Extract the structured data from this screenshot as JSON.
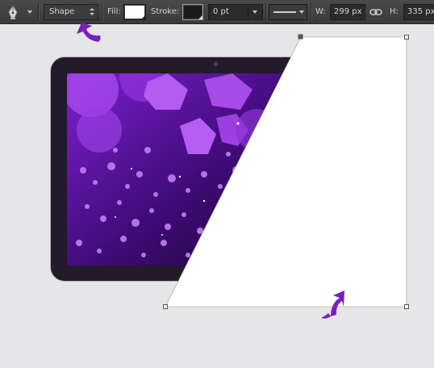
{
  "toolbar": {
    "tool_icon": "pen-tool-icon",
    "mode_value": "Shape",
    "fill_label": "Fill:",
    "fill_color": "#ffffff",
    "stroke_label": "Stroke:",
    "stroke_color": "#1b1b1b",
    "stroke_width_value": "0 pt",
    "width_label": "W:",
    "width_value": "299 px",
    "link_icon": "link-icon",
    "height_label": "H:",
    "height_value": "335 px"
  },
  "canvas": {
    "background": "#e6e5e8",
    "shape_fill": "#ffffff",
    "annotation_color": "#7b1fc0",
    "screen_image": "purple-bokeh-photo"
  }
}
